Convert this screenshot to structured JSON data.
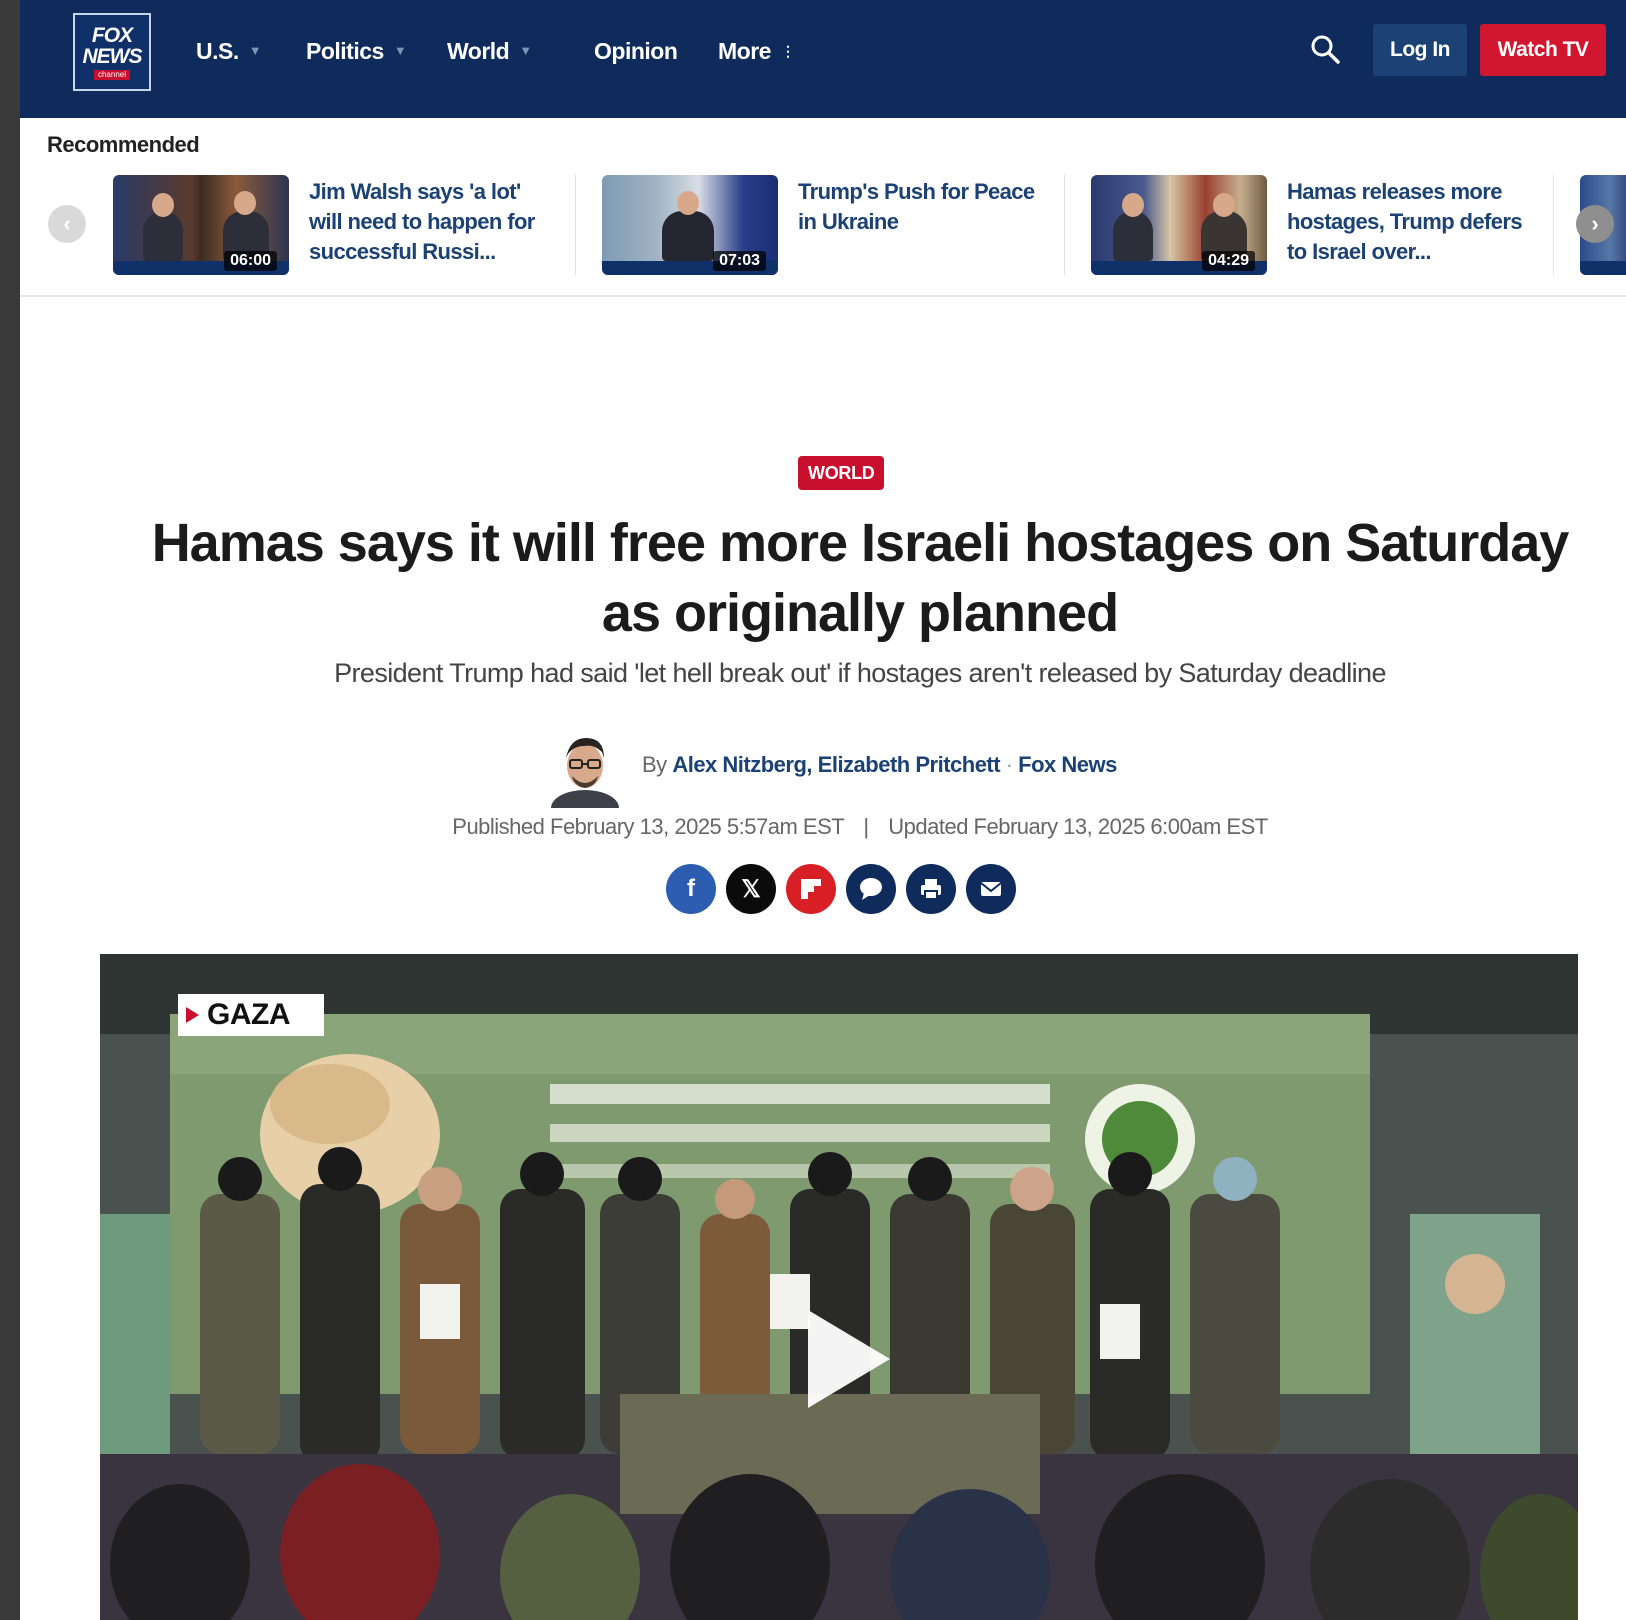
{
  "header": {
    "logo": {
      "line1": "FOX",
      "line2": "NEWS",
      "line3": "channel"
    },
    "nav": [
      {
        "label": "U.S.",
        "has_dropdown": true
      },
      {
        "label": "Politics",
        "has_dropdown": true
      },
      {
        "label": "World",
        "has_dropdown": true
      },
      {
        "label": "Opinion",
        "has_dropdown": false
      },
      {
        "label": "More",
        "has_dropdown": false
      }
    ],
    "search_icon": "search-icon",
    "login_label": "Log In",
    "watch_label": "Watch TV",
    "colors": {
      "nav_bg": "#0e2b5c",
      "watch_bg": "#d1162f",
      "login_bg": "#1c4275"
    }
  },
  "recommended": {
    "title": "Recommended",
    "prev_icon": "chevron-left-icon",
    "next_icon": "chevron-right-icon",
    "items": [
      {
        "title": "Jim Walsh says 'a lot' will need to happen for successful Russi...",
        "duration": "06:00"
      },
      {
        "title": "Trump's Push for Peace in Ukraine",
        "duration": "07:03"
      },
      {
        "title": "Hamas releases more hostages, Trump defers to Israel over...",
        "duration": "04:29"
      }
    ]
  },
  "article": {
    "category": "WORLD",
    "headline": "Hamas says it will free more Israeli hostages on Saturday as originally planned",
    "subhead": "President Trump had said 'let hell break out' if hostages aren't released by Saturday deadline",
    "byline_prefix": "By",
    "authors": [
      "Alex Nitzberg",
      "Elizabeth Pritchett"
    ],
    "outlet": "Fox News",
    "published": "Published February 13, 2025 5:57am EST",
    "separator": "|",
    "updated": "Updated February 13, 2025 6:00am EST",
    "share_icons": [
      "facebook-icon",
      "x-icon",
      "flipboard-icon",
      "comment-icon",
      "print-icon",
      "email-icon"
    ]
  },
  "video": {
    "location_tag": "GAZA",
    "play_icon": "play-icon"
  }
}
